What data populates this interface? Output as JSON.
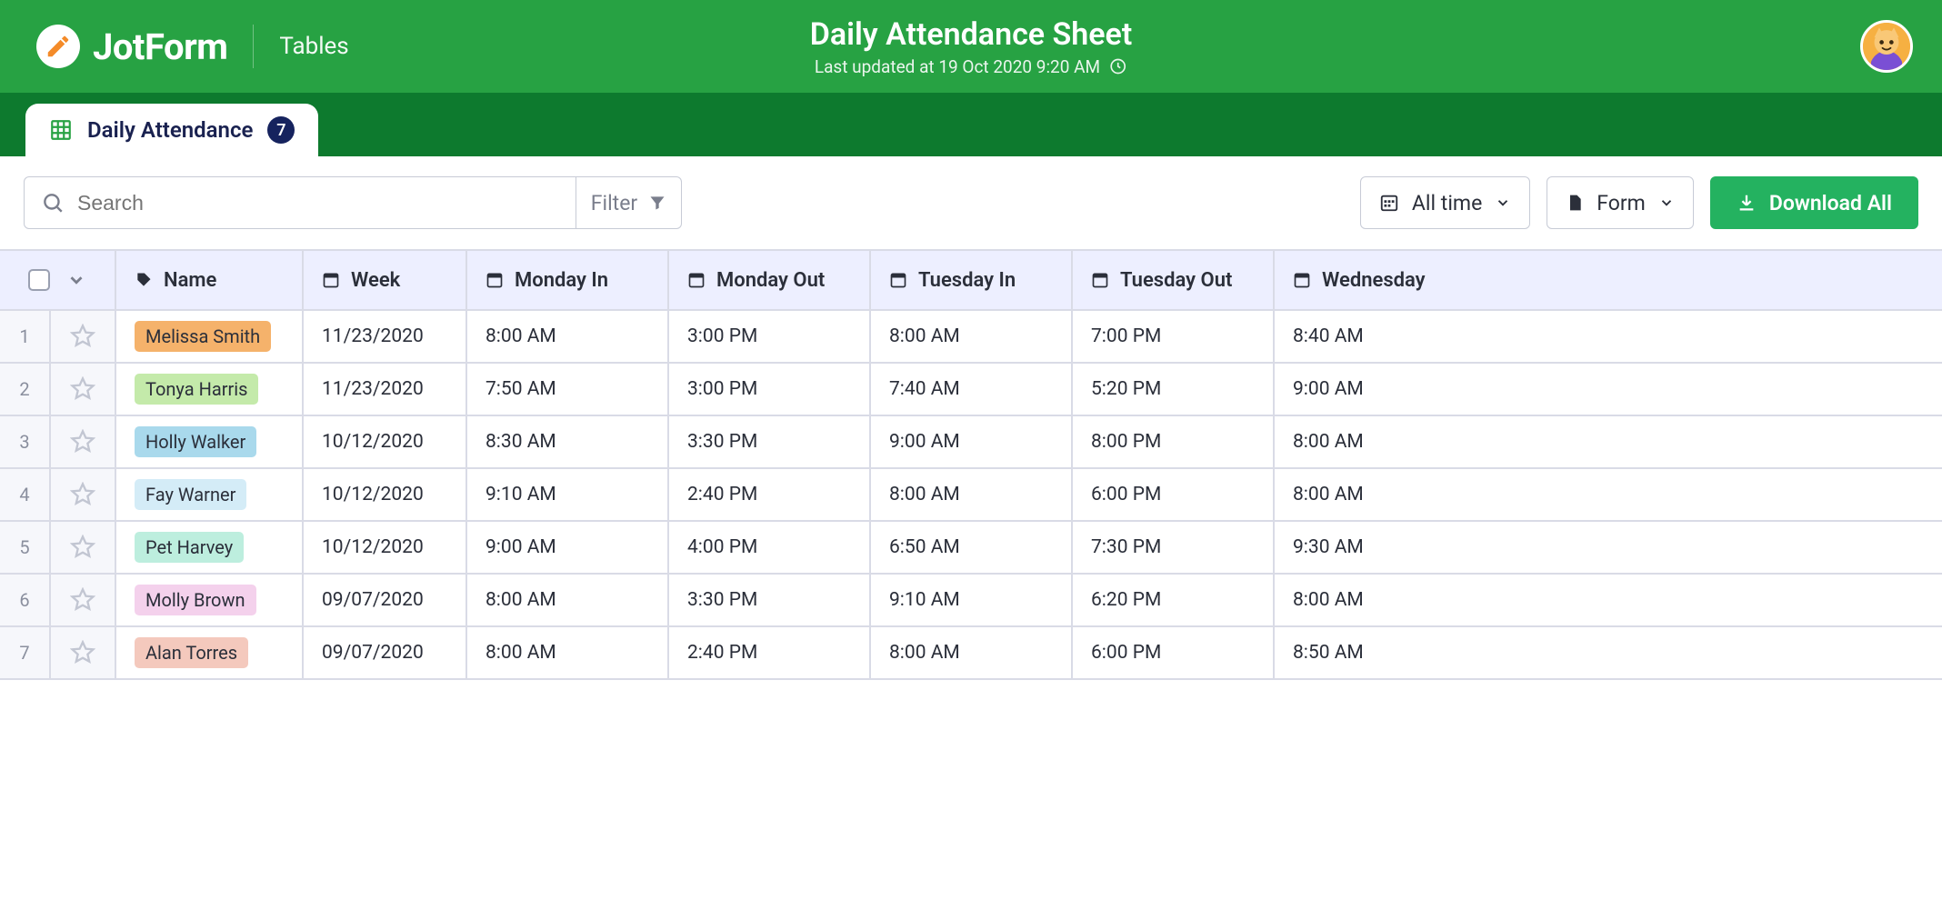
{
  "brand": {
    "name": "JotForm",
    "section": "Tables"
  },
  "header": {
    "title": "Daily Attendance Sheet",
    "subtitle": "Last updated at 19 Oct 2020 9:20 AM"
  },
  "tab": {
    "label": "Daily Attendance",
    "count": "7"
  },
  "toolbar": {
    "search_placeholder": "Search",
    "filter_label": "Filter",
    "time_label": "All time",
    "form_label": "Form",
    "download_label": "Download All"
  },
  "columns": {
    "name": "Name",
    "week": "Week",
    "mon_in": "Monday In",
    "mon_out": "Monday Out",
    "tue_in": "Tuesday In",
    "tue_out": "Tuesday Out",
    "wed": "Wednesday"
  },
  "rows": [
    {
      "n": "1",
      "name": "Melissa Smith",
      "color": "#f5b26b",
      "week": "11/23/2020",
      "mi": "8:00 AM",
      "mo": "3:00 PM",
      "ti": "8:00 AM",
      "to": "7:00 PM",
      "wi": "8:40 AM"
    },
    {
      "n": "2",
      "name": "Tonya Harris",
      "color": "#c4eaaa",
      "week": "11/23/2020",
      "mi": "7:50 AM",
      "mo": "3:00 PM",
      "ti": "7:40 AM",
      "to": "5:20 PM",
      "wi": "9:00 AM"
    },
    {
      "n": "3",
      "name": "Holly Walker",
      "color": "#a9d9ec",
      "week": "10/12/2020",
      "mi": "8:30 AM",
      "mo": "3:30 PM",
      "ti": "9:00 AM",
      "to": "8:00 PM",
      "wi": "8:00 AM"
    },
    {
      "n": "4",
      "name": "Fay Warner",
      "color": "#d4ecf7",
      "week": "10/12/2020",
      "mi": "9:10 AM",
      "mo": "2:40 PM",
      "ti": "8:00 AM",
      "to": "6:00 PM",
      "wi": "8:00 AM"
    },
    {
      "n": "5",
      "name": "Pet Harvey",
      "color": "#bdeede",
      "week": "10/12/2020",
      "mi": "9:00 AM",
      "mo": "4:00 PM",
      "ti": "6:50 AM",
      "to": "7:30 PM",
      "wi": "9:30 AM"
    },
    {
      "n": "6",
      "name": "Molly Brown",
      "color": "#f4d1ec",
      "week": "09/07/2020",
      "mi": "8:00 AM",
      "mo": "3:30 PM",
      "ti": "9:10 AM",
      "to": "6:20 PM",
      "wi": "8:00 AM"
    },
    {
      "n": "7",
      "name": "Alan Torres",
      "color": "#f4c9bd",
      "week": "09/07/2020",
      "mi": "8:00 AM",
      "mo": "2:40 PM",
      "ti": "8:00 AM",
      "to": "6:00 PM",
      "wi": "8:50 AM"
    }
  ]
}
